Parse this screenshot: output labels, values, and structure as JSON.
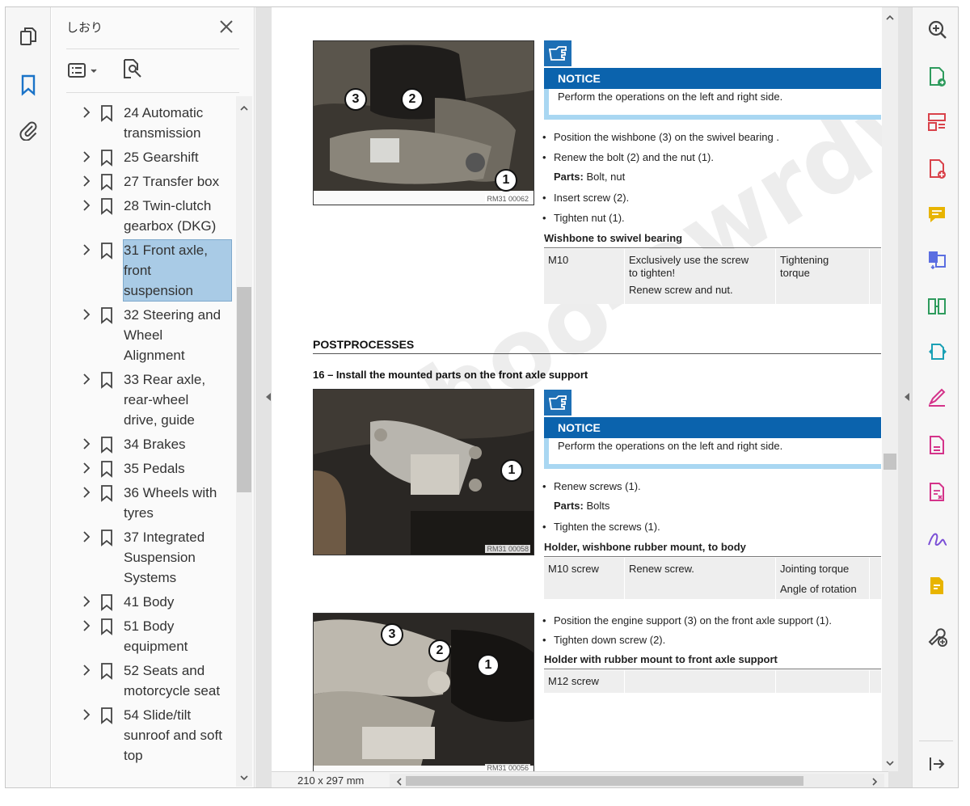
{
  "panel": {
    "title": "しおり",
    "close_icon": "close-icon",
    "list_options_icon": "list-options-icon",
    "find_bookmark_icon": "find-bookmark-icon"
  },
  "bookmarks": [
    {
      "label": "24 Automatic transmission",
      "lines": [
        "24 Automatic",
        "transmission"
      ],
      "selected": false
    },
    {
      "label": "25 Gearshift",
      "lines": [
        "25 Gearshift"
      ],
      "selected": false
    },
    {
      "label": "27 Transfer box",
      "lines": [
        "27 Transfer box"
      ],
      "selected": false
    },
    {
      "label": "28 Twin-clutch gearbox (DKG)",
      "lines": [
        "28 Twin-clutch",
        "gearbox (DKG)"
      ],
      "selected": false
    },
    {
      "label": "31 Front axle, front suspension",
      "lines": [
        "31 Front axle,",
        "front",
        "suspension"
      ],
      "selected": true
    },
    {
      "label": "32 Steering and Wheel Alignment",
      "lines": [
        "32 Steering and",
        "Wheel",
        "Alignment"
      ],
      "selected": false
    },
    {
      "label": "33 Rear axle, rear-wheel drive, guide",
      "lines": [
        "33 Rear axle,",
        "rear-wheel",
        "drive, guide"
      ],
      "selected": false
    },
    {
      "label": "34 Brakes",
      "lines": [
        "34 Brakes"
      ],
      "selected": false
    },
    {
      "label": "35 Pedals",
      "lines": [
        "35 Pedals"
      ],
      "selected": false
    },
    {
      "label": "36 Wheels with tyres",
      "lines": [
        "36 Wheels with",
        "tyres"
      ],
      "selected": false
    },
    {
      "label": "37 Integrated Suspension Systems",
      "lines": [
        "37 Integrated",
        "Suspension",
        "Systems"
      ],
      "selected": false
    },
    {
      "label": "41 Body",
      "lines": [
        "41 Body"
      ],
      "selected": false
    },
    {
      "label": "51 Body equipment",
      "lines": [
        "51 Body",
        "equipment"
      ],
      "selected": false
    },
    {
      "label": "52 Seats and motorcycle seat",
      "lines": [
        "52 Seats and",
        "motorcycle seat"
      ],
      "selected": false
    },
    {
      "label": "54 Slide/tilt sunroof and soft top",
      "lines": [
        "54 Slide/tilt",
        "sunroof and soft",
        "top"
      ],
      "selected": false
    }
  ],
  "document": {
    "page_size": "210 x 297 mm",
    "watermark": "yahoo-awrdwz",
    "block1": {
      "photo_id": "RM31 00062",
      "callouts": [
        "1",
        "2",
        "3"
      ],
      "notice_title": "NOTICE",
      "notice_text": "Perform the operations on the left and right side.",
      "bullets": [
        "Position the wishbone (3) on the swivel bearing .",
        "Renew the bolt (2) and the nut (1).",
        "Insert screw (2).",
        "Tighten nut (1)."
      ],
      "parts_label": "Parts:",
      "parts_value": "Bolt, nut",
      "table_title": "Wishbone to swivel bearing",
      "table": {
        "col1": "M10",
        "col2_line1": "Exclusively use the screw",
        "col2_line2": "to tighten!",
        "col2_line3": "Renew screw and nut.",
        "col3_line1": "Tightening",
        "col3_line2": "torque"
      }
    },
    "section_title": "POSTPROCESSES",
    "step_title": "16 – Install the mounted parts on the front axle support",
    "block2": {
      "photo_id": "RM31 00058",
      "callouts": [
        "1"
      ],
      "notice_title": "NOTICE",
      "notice_text": "Perform the operations on the left and right side.",
      "bullets": [
        "Renew screws (1).",
        "Tighten the screws (1)."
      ],
      "parts_label": "Parts:",
      "parts_value": "Bolts",
      "table_title": "Holder, wishbone rubber mount, to body",
      "table": {
        "col1": "M10 screw",
        "col2": "Renew screw.",
        "col3_line1": "Jointing torque",
        "col3_line2": "Angle of rotation"
      }
    },
    "block3": {
      "photo_id": "RM31 00056",
      "callouts": [
        "1",
        "2",
        "3"
      ],
      "bullets": [
        "Position the engine support (3) on the front axle support (1).",
        "Tighten down screw (2)."
      ],
      "table_title": "Holder with rubber mount to front axle support",
      "table": {
        "col1": "M12 screw"
      }
    }
  },
  "right_tools": [
    "zoom-icon",
    "export-pdf-icon",
    "organize-pages-icon",
    "create-pdf-icon",
    "comment-icon",
    "combine-files-icon",
    "compress-pdf-icon",
    "convert-pdf-icon",
    "fill-sign-icon",
    "edit-pdf-icon",
    "redact-icon",
    "signature-icon",
    "request-signature-icon",
    "more-tools-icon",
    "expand-panel-icon"
  ]
}
